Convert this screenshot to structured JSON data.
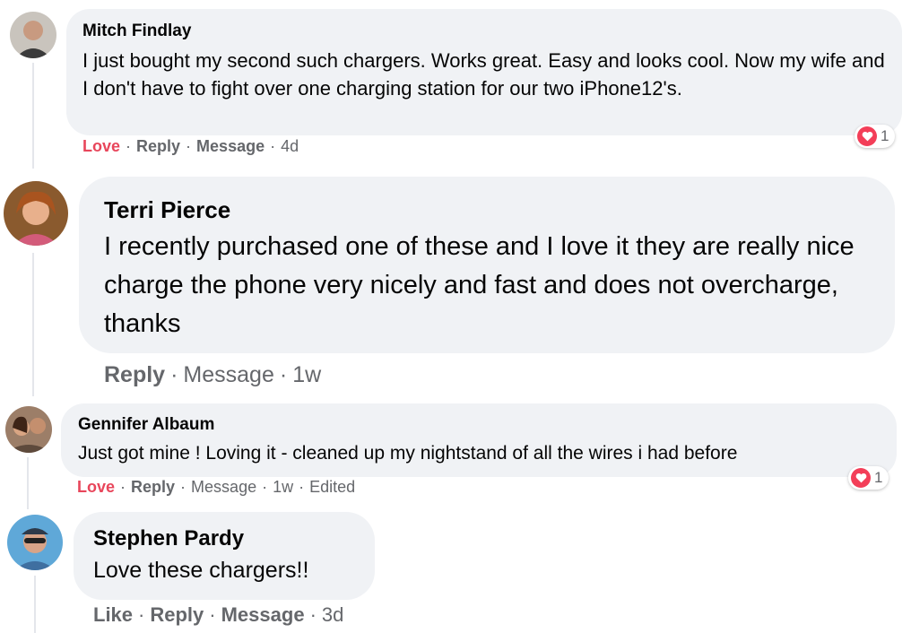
{
  "comments": [
    {
      "author": "Mitch Findlay",
      "text": "I just bought my second such chargers. Works great. Easy and looks cool. Now my wife and I don't have to fight over one charging station for our two iPhone12's.",
      "actions": {
        "react": "Love",
        "reply": "Reply",
        "message": "Message"
      },
      "time": "4d",
      "reaction": {
        "icon": "heart-icon",
        "count": "1"
      }
    },
    {
      "author": "Terri Pierce",
      "text": "I recently purchased one of these and I love it they are really nice charge the phone very nicely and fast and does not overcharge, thanks",
      "actions": {
        "reply": "Reply",
        "message": "Message"
      },
      "time": "1w"
    },
    {
      "author": "Gennifer Albaum",
      "text": "Just got mine ! Loving it - cleaned up my nightstand of all the wires i had before",
      "actions": {
        "react": "Love",
        "reply": "Reply",
        "message": "Message"
      },
      "time": "1w",
      "edited": "Edited",
      "reaction": {
        "icon": "heart-icon",
        "count": "1"
      }
    },
    {
      "author": "Stephen Pardy",
      "text": "Love these chargers!!",
      "actions": {
        "react": "Like",
        "reply": "Reply",
        "message": "Message"
      },
      "time": "3d"
    }
  ],
  "colors": {
    "bubble": "#f0f2f5",
    "love": "#e8465b",
    "secondary_text": "#65676b",
    "heart": "#f33e58"
  }
}
